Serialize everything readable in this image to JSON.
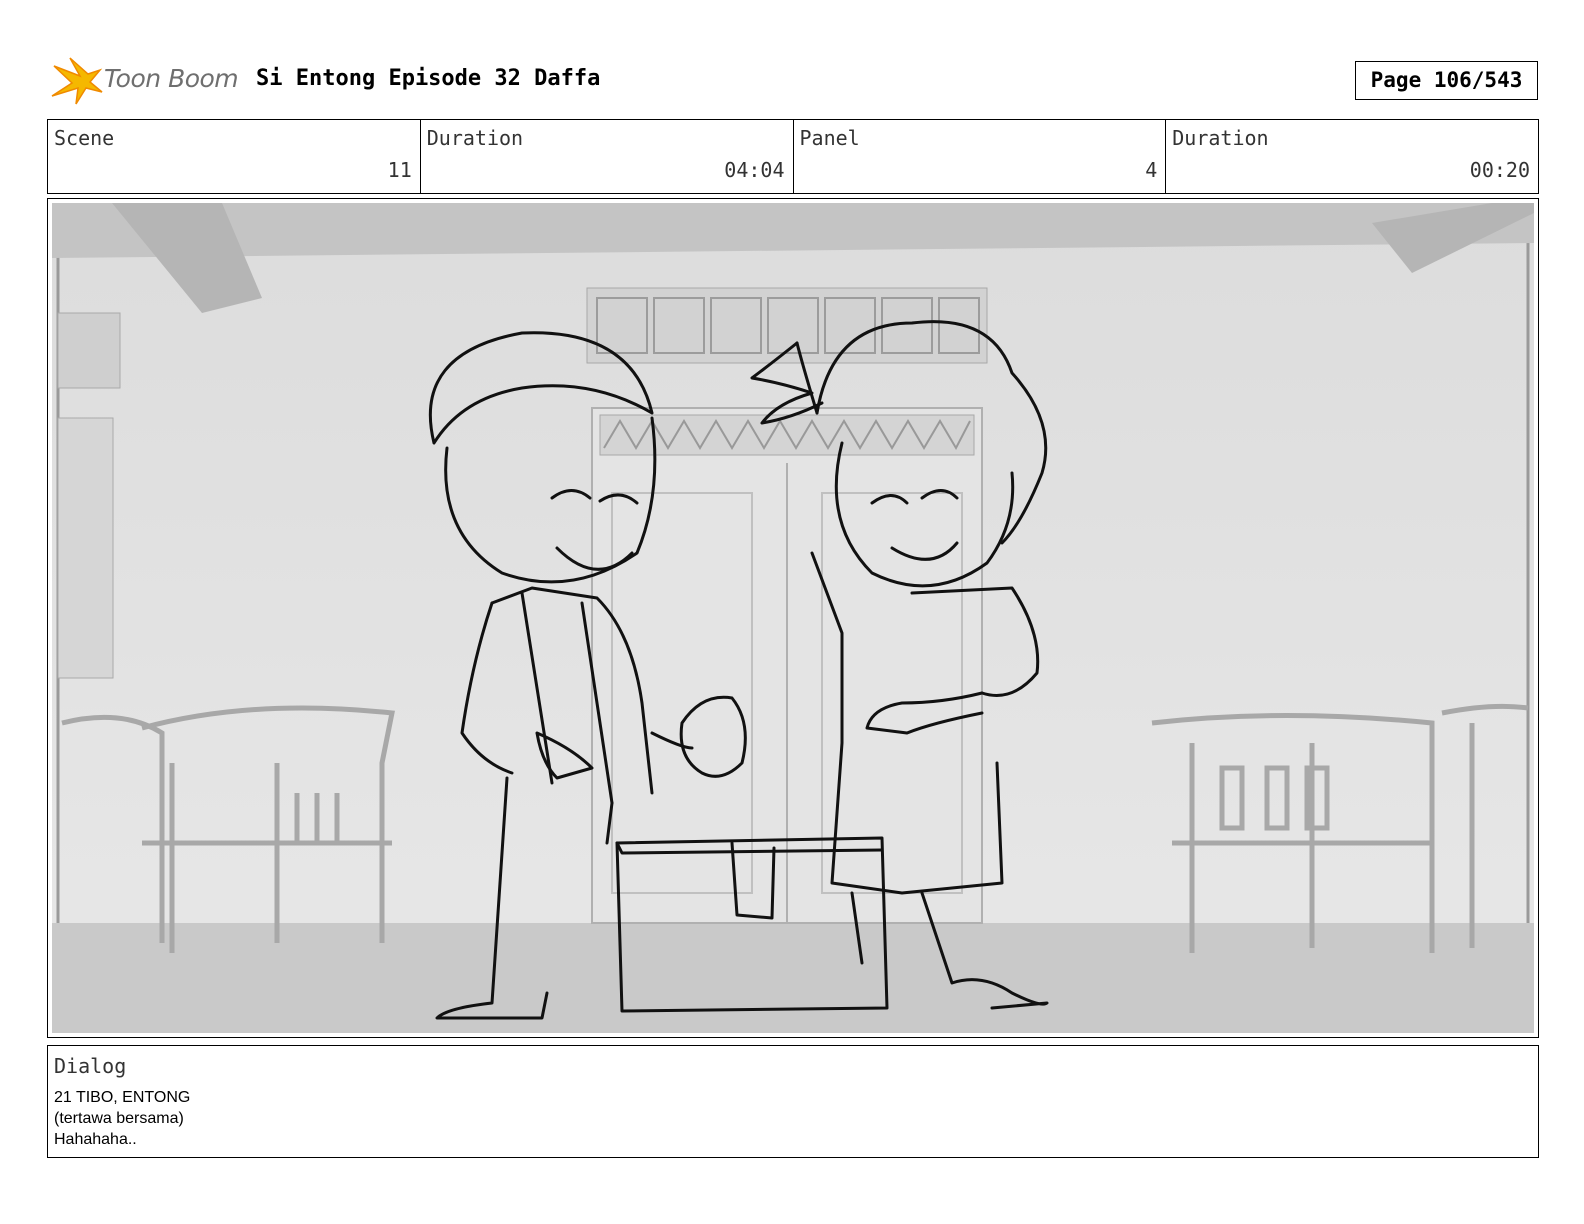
{
  "header": {
    "logo_text": "Toon Boom",
    "title": "Si Entong Episode 32 Daffa",
    "page": "Page 106/543"
  },
  "info": {
    "scene_label": "Scene",
    "scene_value": "11",
    "scene_duration_label": "Duration",
    "scene_duration_value": "04:04",
    "panel_label": "Panel",
    "panel_value": "4",
    "panel_duration_label": "Duration",
    "panel_duration_value": "00:20"
  },
  "dialog": {
    "label": "Dialog",
    "lines": [
      "21 TIBO, ENTONG",
      "(tertawa bersama)",
      "Hahahaha.."
    ]
  },
  "colors": {
    "logo_yellow": "#f5b800",
    "logo_orange": "#f08a00"
  }
}
